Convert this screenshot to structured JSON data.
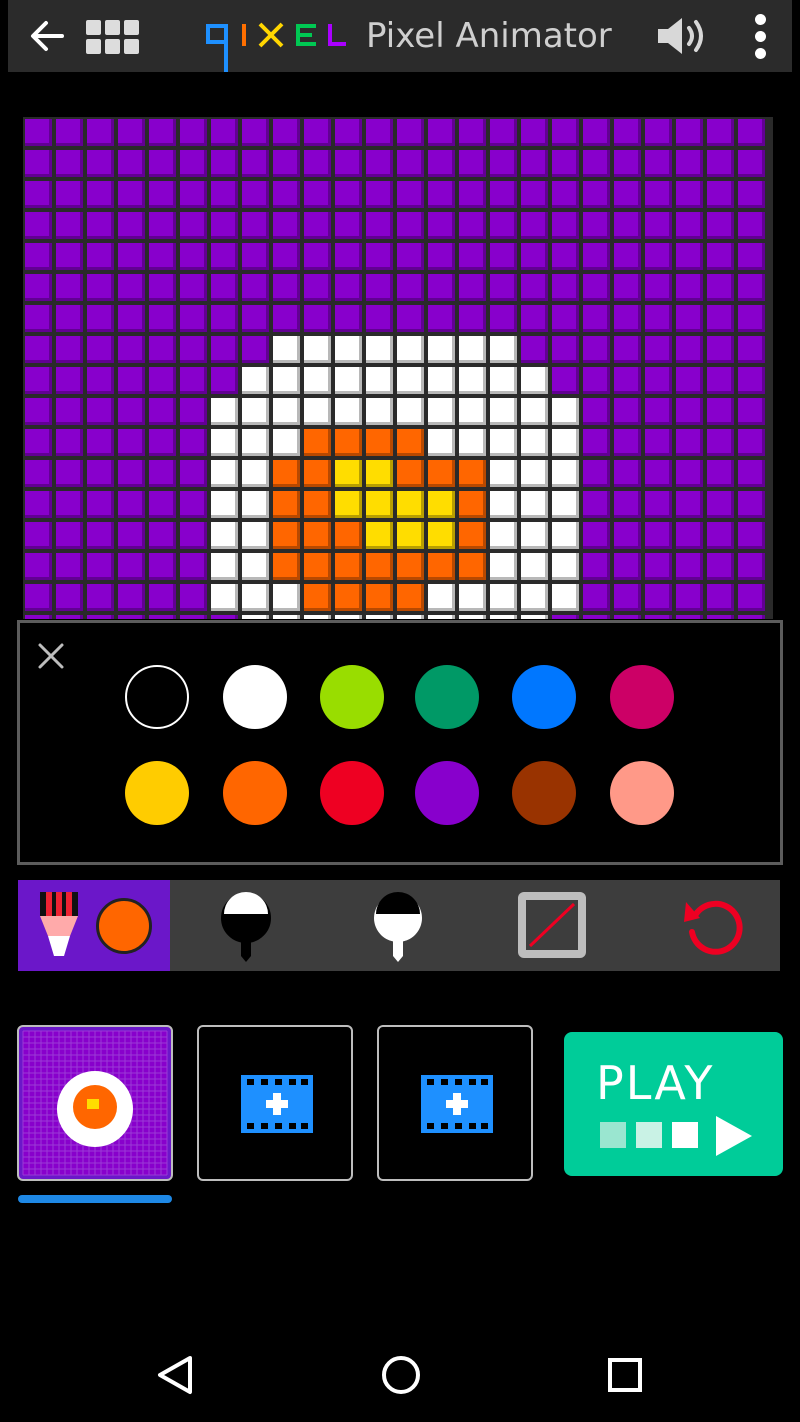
{
  "app": {
    "logo_text": "qixel",
    "title": "Pixel Animator",
    "logo_colors": [
      "#1e90ff",
      "#ff6f00",
      "#ffd600",
      "#00c853",
      "#aa00ff"
    ]
  },
  "icons": {
    "back": "arrow-left-icon",
    "gallery": "grid-icon",
    "sound": "speaker-icon",
    "menu": "kebab-menu-icon",
    "close": "close-icon",
    "pencil": "pencil-icon",
    "fill_bucket": "fill-icon",
    "eraser_fill": "fill-inverse-icon",
    "clear_frame": "frame-clear-icon",
    "undo": "undo-icon",
    "add_frame": "add-frame-icon",
    "nav_back": "triangle-back-icon",
    "nav_home": "circle-home-icon",
    "nav_recent": "square-recent-icon"
  },
  "palette": {
    "colors": [
      "#000000",
      "#ffffff",
      "#99dd00",
      "#009966",
      "#0077ff",
      "#cc0066",
      "#ffcc00",
      "#ff6600",
      "#ee0022",
      "#8800cc",
      "#993300",
      "#ff9988"
    ]
  },
  "toolbar": {
    "current_color": "#ff6600",
    "accent": "#6b17c9"
  },
  "frames": {
    "count_shown": 3,
    "active_index": 0
  },
  "play": {
    "label": "PLAY",
    "color": "#00cc99"
  },
  "canvas": {
    "background_color": "#8800cc",
    "colors": {
      "P": "#8800cc",
      "W": "#ffffff",
      "O": "#ff6600",
      "Y": "#ffdd00"
    },
    "rows": [
      "PPPPPPPPPPPPPPPPPPPPPPPP",
      "PPPPPPPPPPPPPPPPPPPPPPPP",
      "PPPPPPPPPPPPPPPPPPPPPPPP",
      "PPPPPPPPPPPPPPPPPPPPPPPP",
      "PPPPPPPPPPPPPPPPPPPPPPPP",
      "PPPPPPPPPPPPPPPPPPPPPPPP",
      "PPPPPPPPPPPPPPPPPPPPPPPP",
      "PPPPPPPPWWWWWWWWPPPPPPPP",
      "PPPPPPPWWWWWWWWWWPPPPPPP",
      "PPPPPPWWWWWWWWWWWWPPPPPP",
      "PPPPPPWWWOOOOWWWWWPPPPPP",
      "PPPPPPWWOOYYOOOWWWPPPPPP",
      "PPPPPPWWOOYYYYOWWWPPPPPP",
      "PPPPPPWWOOOYYYOWWWPPPPPP",
      "PPPPPPWWOOOOOOOWWWPPPPPP",
      "PPPPPPWWWOOOOWWWWWPPPPPP",
      "PPPPPPPWWWWWWWWWWPPPPPPP"
    ]
  }
}
